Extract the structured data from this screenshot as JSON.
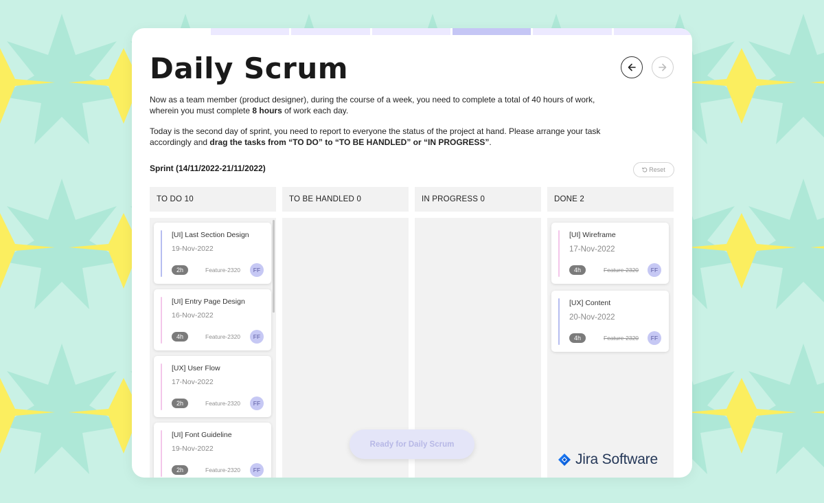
{
  "page": {
    "title": "Daily Scrum",
    "intro_1_pre": "Now as a team member (product designer), during the course of a week, you need to complete a total of 40 hours of work, wherein you must complete ",
    "intro_1_bold": "8 hours",
    "intro_1_post": " of work each day.",
    "intro_2_pre": "Today is the second day of sprint, you need to report to everyone the status of the project at hand. Please arrange your task accordingly and ",
    "intro_2_bold": "drag the tasks from “TO DO” to “TO BE HANDLED” or “IN PROGRESS”",
    "intro_2_post": ".",
    "sprint_label": "Sprint (14/11/2022-21/11/2022)",
    "reset_label": "Reset",
    "ready_label": "Ready for Daily Scrum",
    "brand": "Jira Software"
  },
  "progress_tabs": {
    "count": 6,
    "active_index": 3
  },
  "icons": {
    "prev": "arrow-left-icon",
    "next": "arrow-right-icon",
    "reset": "reset-icon",
    "brand": "jira-logo-icon"
  },
  "colors": {
    "accent": "#c5c6f5",
    "bar_ui": "#b6bdf0",
    "bar_ux": "#f3c6ea",
    "avatar": "#c6c8f4",
    "background_yellow": "#fbee5f",
    "background_mint": "#c9f1e5"
  },
  "columns": [
    {
      "header": "TO DO 10",
      "tasks": [
        {
          "title": "[UI] Last Section Design",
          "date": "19-Nov-2022",
          "hours": "2h",
          "feature": "Feature-2320",
          "assignee": "FF"
        },
        {
          "title": "[UI] Entry Page Design",
          "date": "16-Nov-2022",
          "hours": "4h",
          "feature": "Feature-2320",
          "assignee": "FF"
        },
        {
          "title": "[UX] User Flow",
          "date": "17-Nov-2022",
          "hours": "2h",
          "feature": "Feature-2320",
          "assignee": "FF"
        },
        {
          "title": "[UI] Font Guideline",
          "date": "19-Nov-2022",
          "hours": "2h",
          "feature": "Feature-2320",
          "assignee": "FF"
        }
      ]
    },
    {
      "header": "TO BE HANDLED 0",
      "tasks": []
    },
    {
      "header": "IN PROGRESS 0",
      "tasks": []
    },
    {
      "header": "DONE 2",
      "tasks": [
        {
          "title": "[UI] Wireframe",
          "date": "17-Nov-2022",
          "hours": "4h",
          "feature": "Feature-2320",
          "assignee": "FF"
        },
        {
          "title": "[UX] Content",
          "date": "20-Nov-2022",
          "hours": "4h",
          "feature": "Feature-2320",
          "assignee": "FF"
        }
      ]
    }
  ]
}
